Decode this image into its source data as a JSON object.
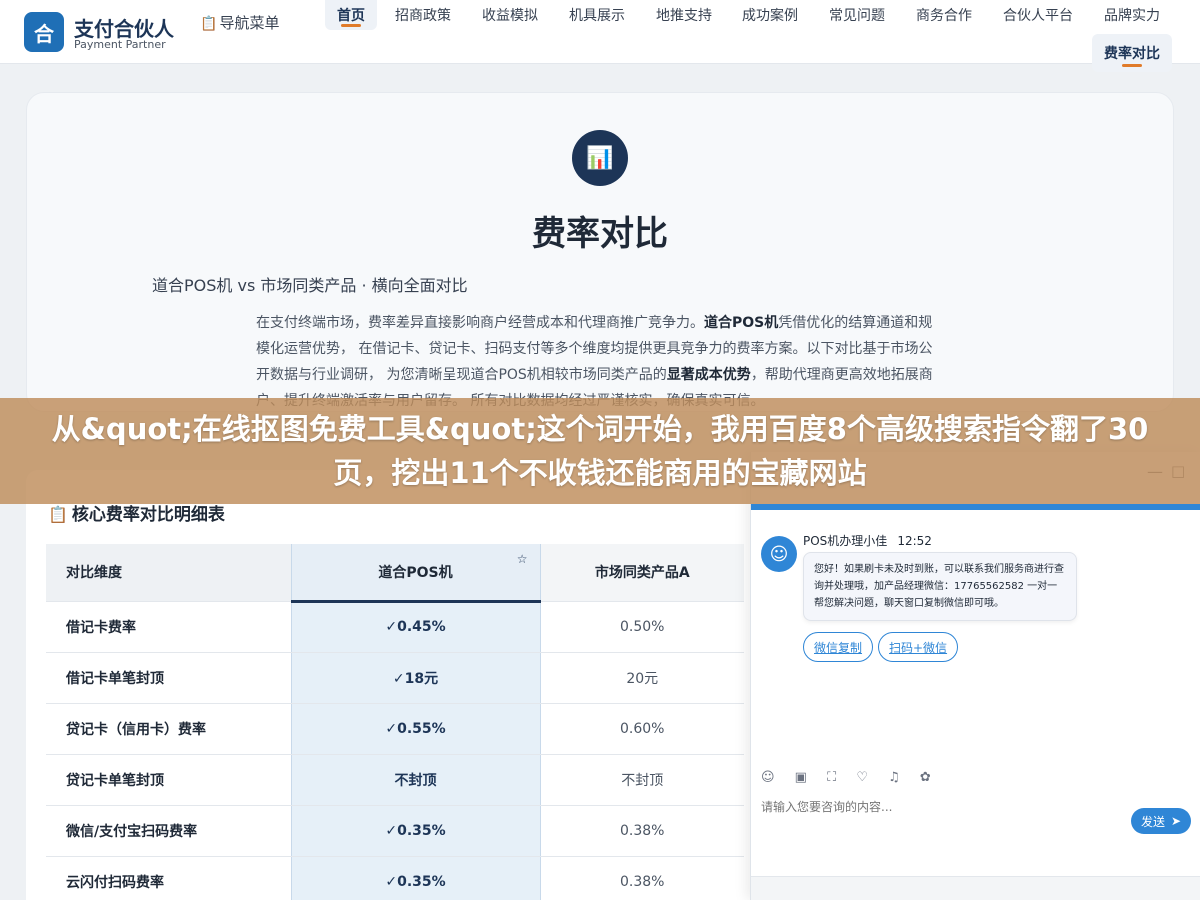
{
  "header": {
    "logo_char": "合",
    "logo_title": "支付合伙人",
    "logo_sub": "Payment Partner",
    "menu_icon": "clipboard-icon",
    "menu_label": "导航菜单",
    "nav": [
      "首页",
      "招商政策",
      "收益模拟",
      "机具展示",
      "地推支持",
      "成功案例",
      "常见问题",
      "商务合作",
      "合伙人平台",
      "品牌实力"
    ],
    "nav_second": "费率对比",
    "active_index": 0
  },
  "hero": {
    "icon": "bar-chart-icon",
    "title": "费率对比",
    "subtitle": "道合POS机 vs 市场同类产品 · 横向全面对比",
    "desc_1": "在支付终端市场，费率差异直接影响商户经营成本和代理商推广竞争力。",
    "desc_bold_1": "道合POS机",
    "desc_2": "凭借优化的结算通道和规模化运营优势， 在借记卡、贷记卡、扫码支付等多个维度均提供更具竞争力的费率方案。以下对比基于市场公开数据与行业调研， 为您清晰呈现道合POS机相较市场同类产品的",
    "desc_bold_2": "显著成本优势",
    "desc_3": "，帮助代理商更高效地拓展商户、提升终端激活率与用户留存。 所有对比数据均经过严谨核实，确保真实可信。"
  },
  "banner": {
    "text": "从&quot;在线抠图免费工具&quot;这个词开始，我用百度8个高级搜索指令翻了30页，挖出11个不收钱还能商用的宝藏网站"
  },
  "table": {
    "heading_icon": "clipboard-icon",
    "heading": "核心费率对比明细表",
    "headers": [
      "对比维度",
      "道合POS机",
      "市场同类产品A"
    ],
    "star": "☆",
    "rows": [
      {
        "dim": "借记卡费率",
        "ours": "✓0.45%",
        "a": "0.50%"
      },
      {
        "dim": "借记卡单笔封顶",
        "ours": "✓18元",
        "a": "20元"
      },
      {
        "dim": "贷记卡（信用卡）费率",
        "ours": "✓0.55%",
        "a": "0.60%"
      },
      {
        "dim": "贷记卡单笔封顶",
        "ours": "不封顶",
        "a": "不封顶"
      },
      {
        "dim": "微信/支付宝扫码费率",
        "ours": "✓0.35%",
        "a": "0.38%"
      },
      {
        "dim": "云闪付扫码费率",
        "ours": "✓0.35%",
        "a": "0.38%"
      }
    ]
  },
  "chat": {
    "minimize": "—",
    "maximize": "□",
    "agent_name": "POS机办理小佳",
    "time": "12:52",
    "message": "您好！如果刷卡未及时到账，可以联系我们服务商进行查询并处理哦，加产品经理微信：17765562582 一对一帮您解决问题，聊天窗口复制微信即可哦。",
    "btn_copy": "微信复制",
    "btn_scan": "扫码+微信",
    "tools": "☺ ▣ ⛶ ♡ ♫ ✿",
    "input_placeholder": "请输入您要咨询的内容...",
    "send": "发送",
    "send_icon": "➤"
  }
}
